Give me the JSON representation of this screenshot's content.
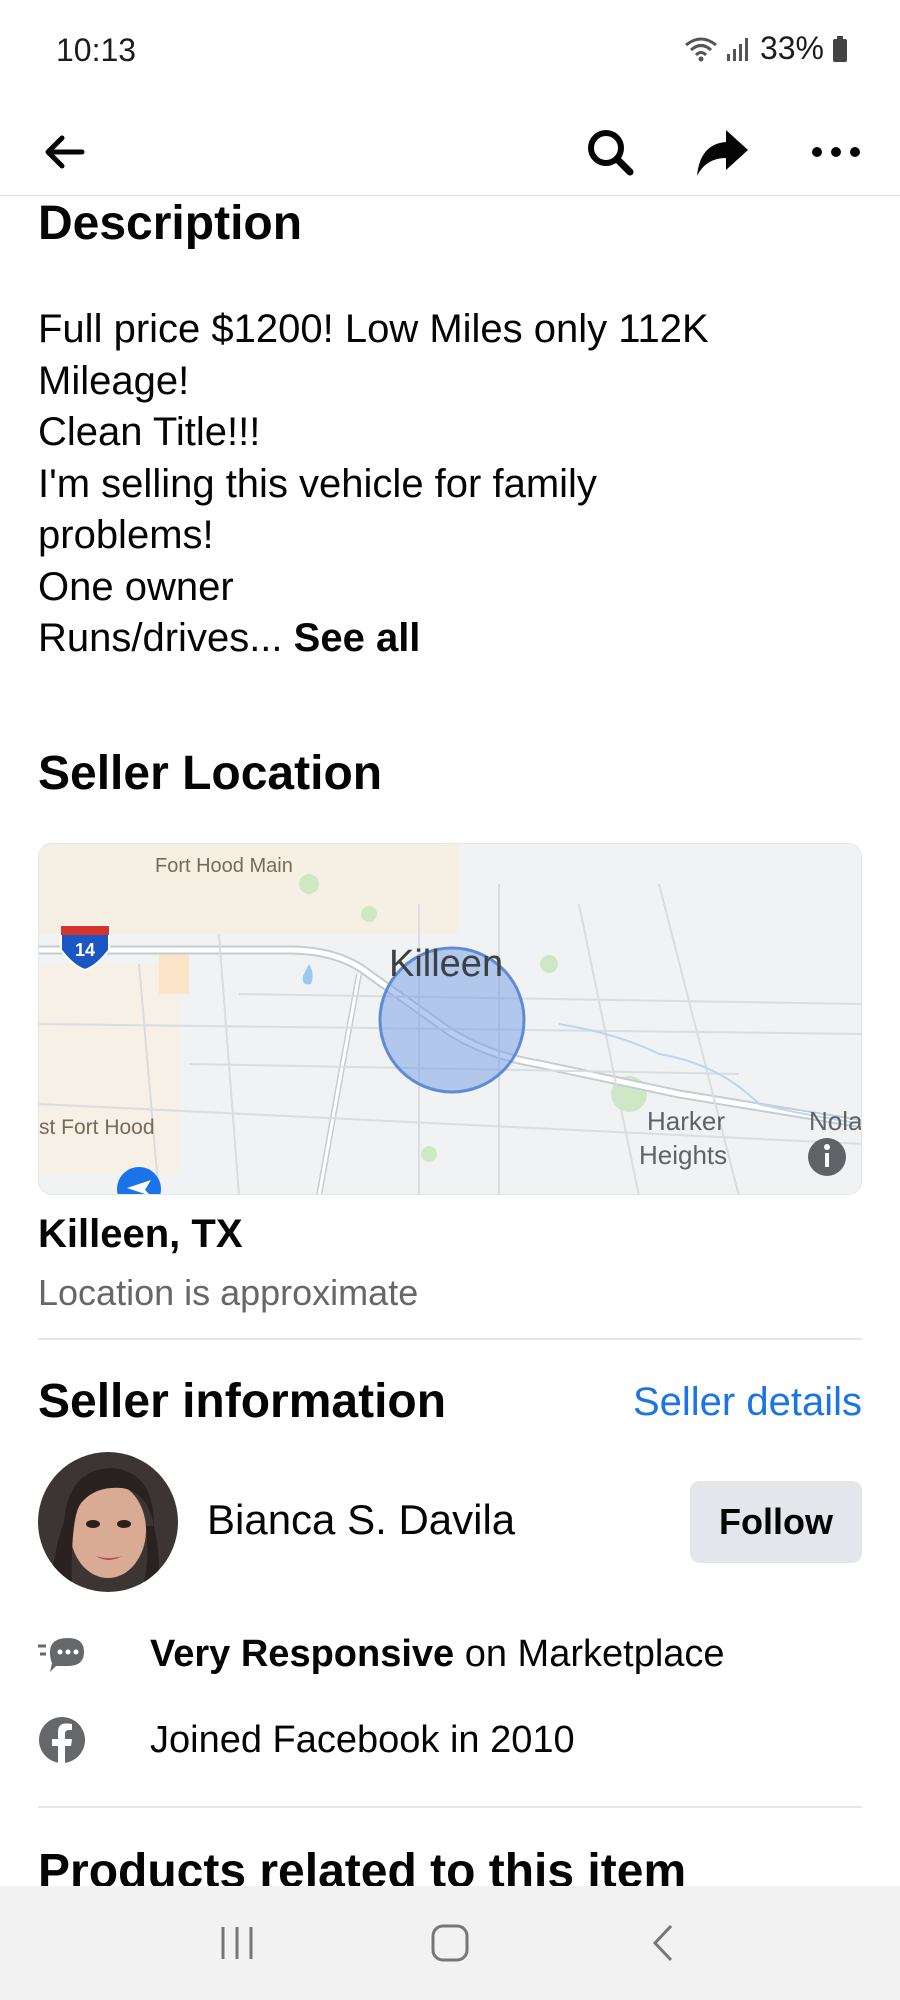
{
  "status_bar": {
    "time": "10:13",
    "battery": "33%"
  },
  "nav": {
    "back": "back-arrow",
    "search": "search-icon",
    "share": "share-icon",
    "more": "more-icon"
  },
  "description": {
    "title": "Description",
    "text": "Full price $1200! Low Miles only 112K\nMileage!\nClean Title!!!\nI'm selling this vehicle for family\nproblems!\nOne owner\nRuns/drives... ",
    "see_all": "See all"
  },
  "location": {
    "title": "Seller Location",
    "map_labels": {
      "fort_hood_main": "Fort Hood Main",
      "interstate": "14",
      "killeen": "Killeen",
      "west_fort_hood": "st Fort Hood",
      "harker": "Harker",
      "heights": "Heights",
      "nolanville": "Nola"
    },
    "city": "Killeen, TX",
    "note": "Location is approximate"
  },
  "seller": {
    "title": "Seller information",
    "details_link": "Seller details",
    "name": "Bianca S. Davila",
    "follow_label": "Follow",
    "responsive_bold": "Very Responsive",
    "responsive_rest": " on Marketplace",
    "joined": "Joined Facebook in 2010"
  },
  "related": {
    "title": "Products related to this item"
  },
  "colors": {
    "link": "#1b74e4",
    "secondary_text": "#65676b",
    "button_bg": "#e4e6eb"
  }
}
